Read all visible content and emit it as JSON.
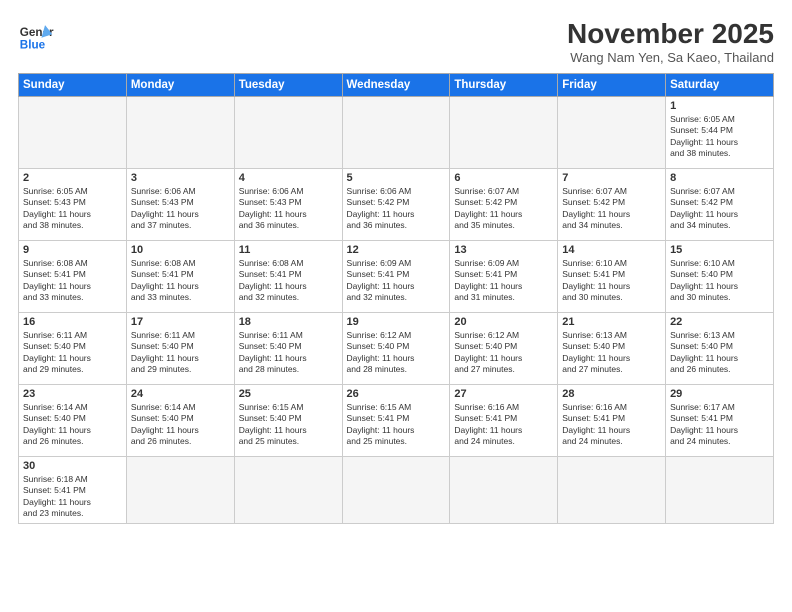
{
  "header": {
    "logo_general": "General",
    "logo_blue": "Blue",
    "month_title": "November 2025",
    "location": "Wang Nam Yen, Sa Kaeo, Thailand"
  },
  "weekdays": [
    "Sunday",
    "Monday",
    "Tuesday",
    "Wednesday",
    "Thursday",
    "Friday",
    "Saturday"
  ],
  "weeks": [
    [
      {
        "day": "",
        "info": ""
      },
      {
        "day": "",
        "info": ""
      },
      {
        "day": "",
        "info": ""
      },
      {
        "day": "",
        "info": ""
      },
      {
        "day": "",
        "info": ""
      },
      {
        "day": "",
        "info": ""
      },
      {
        "day": "1",
        "info": "Sunrise: 6:05 AM\nSunset: 5:44 PM\nDaylight: 11 hours\nand 38 minutes."
      }
    ],
    [
      {
        "day": "2",
        "info": "Sunrise: 6:05 AM\nSunset: 5:43 PM\nDaylight: 11 hours\nand 38 minutes."
      },
      {
        "day": "3",
        "info": "Sunrise: 6:06 AM\nSunset: 5:43 PM\nDaylight: 11 hours\nand 37 minutes."
      },
      {
        "day": "4",
        "info": "Sunrise: 6:06 AM\nSunset: 5:43 PM\nDaylight: 11 hours\nand 36 minutes."
      },
      {
        "day": "5",
        "info": "Sunrise: 6:06 AM\nSunset: 5:42 PM\nDaylight: 11 hours\nand 36 minutes."
      },
      {
        "day": "6",
        "info": "Sunrise: 6:07 AM\nSunset: 5:42 PM\nDaylight: 11 hours\nand 35 minutes."
      },
      {
        "day": "7",
        "info": "Sunrise: 6:07 AM\nSunset: 5:42 PM\nDaylight: 11 hours\nand 34 minutes."
      },
      {
        "day": "8",
        "info": "Sunrise: 6:07 AM\nSunset: 5:42 PM\nDaylight: 11 hours\nand 34 minutes."
      }
    ],
    [
      {
        "day": "9",
        "info": "Sunrise: 6:08 AM\nSunset: 5:41 PM\nDaylight: 11 hours\nand 33 minutes."
      },
      {
        "day": "10",
        "info": "Sunrise: 6:08 AM\nSunset: 5:41 PM\nDaylight: 11 hours\nand 33 minutes."
      },
      {
        "day": "11",
        "info": "Sunrise: 6:08 AM\nSunset: 5:41 PM\nDaylight: 11 hours\nand 32 minutes."
      },
      {
        "day": "12",
        "info": "Sunrise: 6:09 AM\nSunset: 5:41 PM\nDaylight: 11 hours\nand 32 minutes."
      },
      {
        "day": "13",
        "info": "Sunrise: 6:09 AM\nSunset: 5:41 PM\nDaylight: 11 hours\nand 31 minutes."
      },
      {
        "day": "14",
        "info": "Sunrise: 6:10 AM\nSunset: 5:41 PM\nDaylight: 11 hours\nand 30 minutes."
      },
      {
        "day": "15",
        "info": "Sunrise: 6:10 AM\nSunset: 5:40 PM\nDaylight: 11 hours\nand 30 minutes."
      }
    ],
    [
      {
        "day": "16",
        "info": "Sunrise: 6:11 AM\nSunset: 5:40 PM\nDaylight: 11 hours\nand 29 minutes."
      },
      {
        "day": "17",
        "info": "Sunrise: 6:11 AM\nSunset: 5:40 PM\nDaylight: 11 hours\nand 29 minutes."
      },
      {
        "day": "18",
        "info": "Sunrise: 6:11 AM\nSunset: 5:40 PM\nDaylight: 11 hours\nand 28 minutes."
      },
      {
        "day": "19",
        "info": "Sunrise: 6:12 AM\nSunset: 5:40 PM\nDaylight: 11 hours\nand 28 minutes."
      },
      {
        "day": "20",
        "info": "Sunrise: 6:12 AM\nSunset: 5:40 PM\nDaylight: 11 hours\nand 27 minutes."
      },
      {
        "day": "21",
        "info": "Sunrise: 6:13 AM\nSunset: 5:40 PM\nDaylight: 11 hours\nand 27 minutes."
      },
      {
        "day": "22",
        "info": "Sunrise: 6:13 AM\nSunset: 5:40 PM\nDaylight: 11 hours\nand 26 minutes."
      }
    ],
    [
      {
        "day": "23",
        "info": "Sunrise: 6:14 AM\nSunset: 5:40 PM\nDaylight: 11 hours\nand 26 minutes."
      },
      {
        "day": "24",
        "info": "Sunrise: 6:14 AM\nSunset: 5:40 PM\nDaylight: 11 hours\nand 26 minutes."
      },
      {
        "day": "25",
        "info": "Sunrise: 6:15 AM\nSunset: 5:40 PM\nDaylight: 11 hours\nand 25 minutes."
      },
      {
        "day": "26",
        "info": "Sunrise: 6:15 AM\nSunset: 5:41 PM\nDaylight: 11 hours\nand 25 minutes."
      },
      {
        "day": "27",
        "info": "Sunrise: 6:16 AM\nSunset: 5:41 PM\nDaylight: 11 hours\nand 24 minutes."
      },
      {
        "day": "28",
        "info": "Sunrise: 6:16 AM\nSunset: 5:41 PM\nDaylight: 11 hours\nand 24 minutes."
      },
      {
        "day": "29",
        "info": "Sunrise: 6:17 AM\nSunset: 5:41 PM\nDaylight: 11 hours\nand 24 minutes."
      }
    ],
    [
      {
        "day": "30",
        "info": "Sunrise: 6:18 AM\nSunset: 5:41 PM\nDaylight: 11 hours\nand 23 minutes."
      },
      {
        "day": "",
        "info": ""
      },
      {
        "day": "",
        "info": ""
      },
      {
        "day": "",
        "info": ""
      },
      {
        "day": "",
        "info": ""
      },
      {
        "day": "",
        "info": ""
      },
      {
        "day": "",
        "info": ""
      }
    ]
  ]
}
